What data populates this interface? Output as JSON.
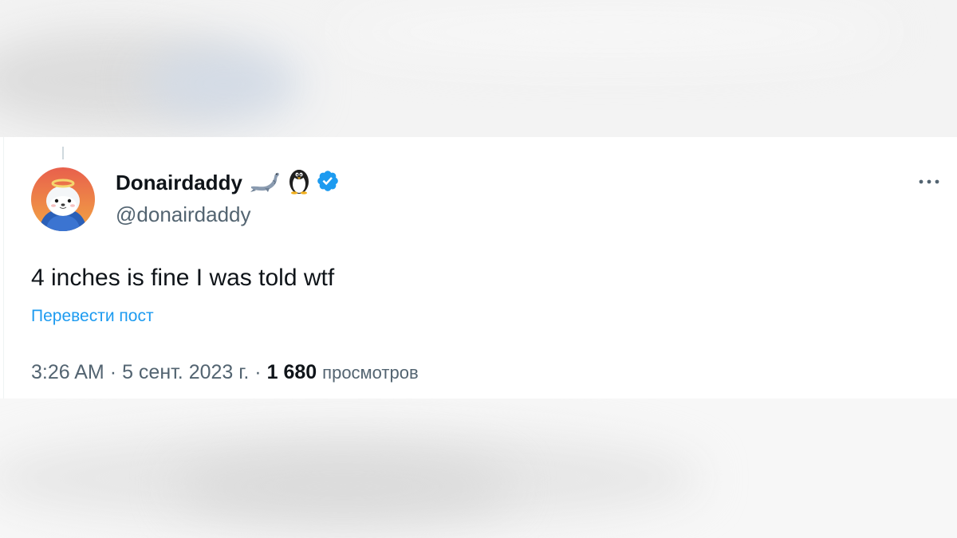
{
  "tweet": {
    "display_name": "Donairdaddy",
    "name_emojis": [
      "seal-icon",
      "penguin-icon"
    ],
    "verified_badge": "verified-badge-icon",
    "handle": "@donairdaddy",
    "text": "4 inches is fine I was told wtf",
    "translate_label": "Перевести пост",
    "time": "3:26 AM",
    "date": "5 сент. 2023 г.",
    "separator": "·",
    "views_count": "1 680",
    "views_label": "просмотров",
    "more_icon": "more-options-icon"
  },
  "colors": {
    "name": "#0f1419",
    "secondary": "#536471",
    "link": "#1d9bf0",
    "verified": "#1d9bf0",
    "avatar_bg_top": "#e8614a",
    "avatar_bg_bottom": "#f0a040"
  }
}
